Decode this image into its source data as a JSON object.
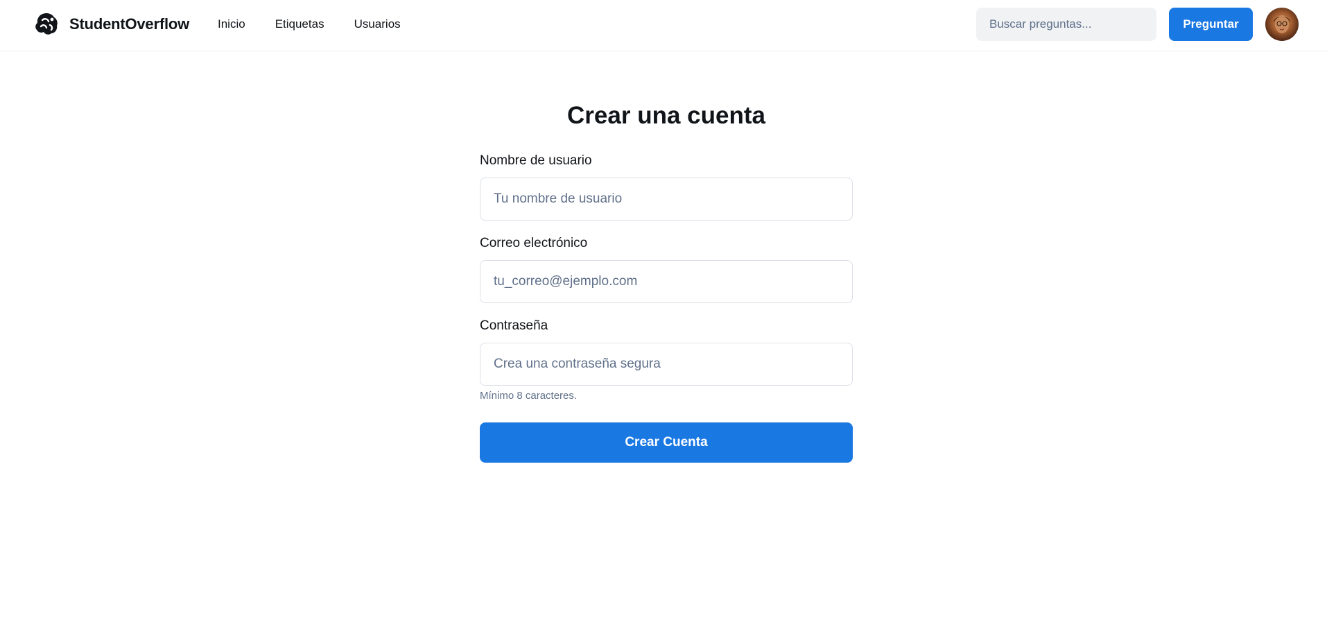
{
  "header": {
    "brand_name": "StudentOverflow",
    "brand_icon": "logo-icon",
    "nav": [
      {
        "label": "Inicio"
      },
      {
        "label": "Etiquetas"
      },
      {
        "label": "Usuarios"
      }
    ],
    "search_placeholder": "Buscar preguntas...",
    "ask_label": "Preguntar",
    "avatar_icon": "user-avatar"
  },
  "form": {
    "title": "Crear una cuenta",
    "username": {
      "label": "Nombre de usuario",
      "placeholder": "Tu nombre de usuario",
      "value": ""
    },
    "email": {
      "label": "Correo electrónico",
      "placeholder": "tu_correo@ejemplo.com",
      "value": ""
    },
    "password": {
      "label": "Contraseña",
      "placeholder": "Crea una contraseña segura",
      "value": "",
      "hint": "Mínimo 8 caracteres."
    },
    "submit_label": "Crear Cuenta"
  },
  "colors": {
    "primary": "#1a78e3",
    "text": "#111418",
    "muted": "#60708a",
    "input_border": "#dbe0e6",
    "search_bg": "#f0f2f4"
  }
}
